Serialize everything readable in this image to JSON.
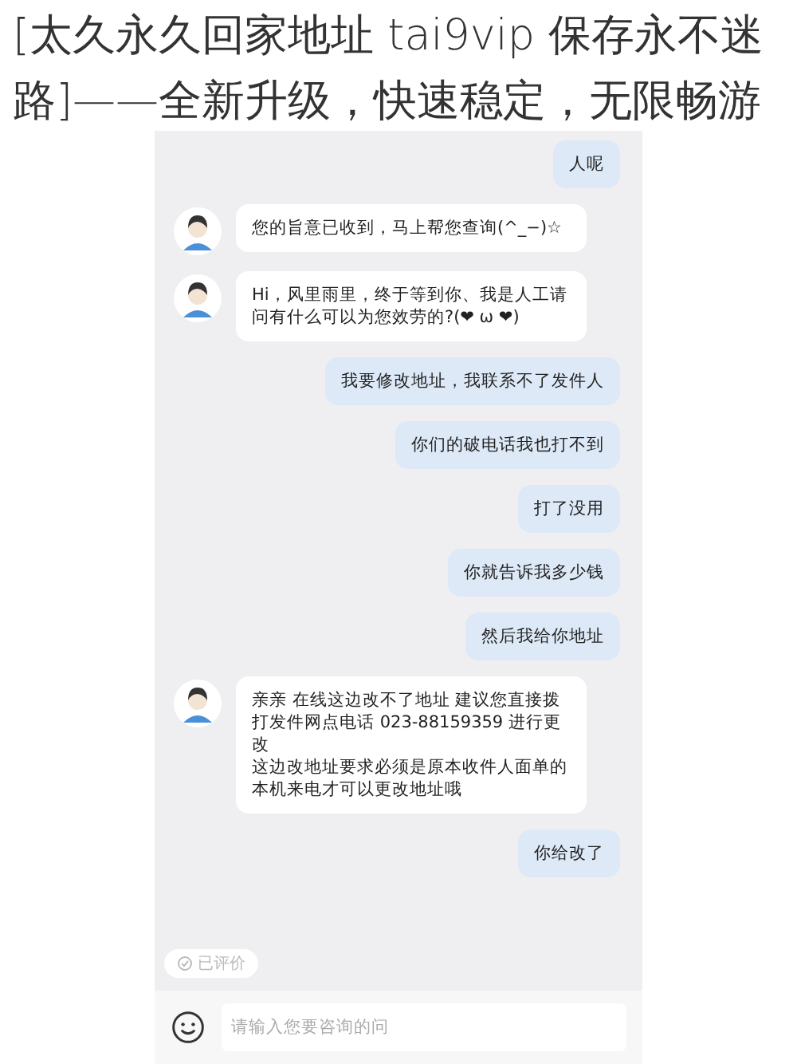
{
  "title": "[太久永久回家地址 tai9vip 保存永不迷路]——全新升级，快速稳定，无限畅游",
  "messages": [
    {
      "kind": "sent",
      "text": "人呢"
    },
    {
      "kind": "received",
      "text": "您的旨意已收到，马上帮您查询(^_−)☆"
    },
    {
      "kind": "received",
      "text": "Hi，风里雨里，终于等到你、我是人工请问有什么可以为您效劳的?(❤ ω ❤)"
    },
    {
      "kind": "sent",
      "text": "我要修改地址，我联系不了发件人"
    },
    {
      "kind": "sent",
      "text": "你们的破电话我也打不到"
    },
    {
      "kind": "sent",
      "text": "打了没用"
    },
    {
      "kind": "sent",
      "text": "你就告诉我多少钱"
    },
    {
      "kind": "sent",
      "text": "然后我给你地址"
    },
    {
      "kind": "received",
      "text": "亲亲 在线这边改不了地址 建议您直接拨打发件网点电话 023-88159359 进行更改",
      "more": "这边改地址要求必须是原本收件人面单的本机来电才可以更改地址哦"
    },
    {
      "kind": "sent",
      "text": "你给改了"
    }
  ],
  "rating_chip": "已评价",
  "input": {
    "placeholder": "请输入您要咨询的问"
  }
}
